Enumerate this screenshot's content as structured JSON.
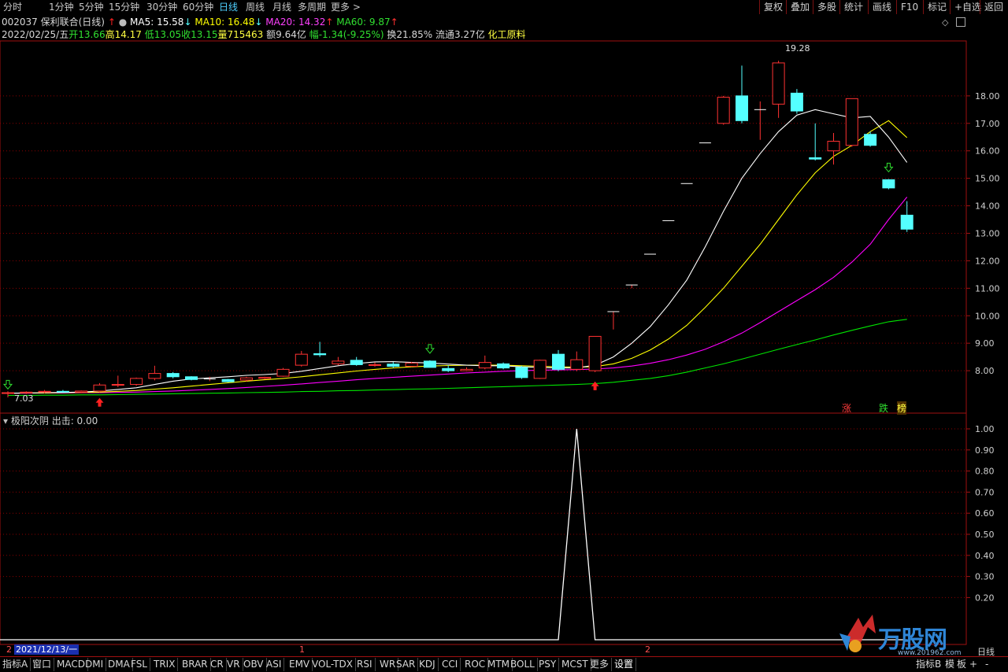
{
  "toolbar": {
    "periods": [
      "分时",
      "1分钟",
      "5分钟",
      "15分钟",
      "30分钟",
      "60分钟",
      "日线",
      "周线",
      "月线",
      "多周期",
      "更多 >"
    ],
    "active_period": "日线",
    "right_buttons": [
      "复权",
      "叠加",
      "多股",
      "统计",
      "画线",
      "F10",
      "标记",
      "+自选",
      "返回"
    ]
  },
  "header": {
    "code_name": "002037 保利联合(日线)",
    "ma5": "MA5: 15.58",
    "ma10": "MA10: 16.48",
    "ma20": "MA20: 14.32",
    "ma60": "MA60: 9.87",
    "date": "2022/02/25/五",
    "open": "开13.66",
    "high": "高14.17",
    "low": "低13.05",
    "close": "收13.15",
    "volume": "量715463",
    "amount": "额9.64亿",
    "change": "幅-1.34(-9.25%)",
    "turnover": "换21.85%",
    "float_cap": "流通3.27亿",
    "sector": "化工原料"
  },
  "colors": {
    "up": "#ff3232",
    "down": "#54ffff",
    "ma5": "#ffffff",
    "ma10": "#ffff00",
    "ma20": "#ff00ff",
    "ma60": "#00e600",
    "grid": "#8b0000",
    "frame": "#a01010"
  },
  "main_chart": {
    "price_ticks": [
      "18.00",
      "17.00",
      "16.00",
      "15.00",
      "14.00",
      "13.00",
      "12.00",
      "11.00",
      "10.00",
      "9.00",
      "8.00"
    ],
    "high_label": "19.28",
    "low_label": "7.03",
    "tags": [
      "涨",
      "跌",
      "榜"
    ]
  },
  "chart_data": [
    {
      "type": "candlestick",
      "title": "002037 保利联合(日线)",
      "ylim": [
        6.6,
        20.0
      ],
      "candles": [
        {
          "o": 7.18,
          "h": 7.25,
          "l": 7.03,
          "c": 7.2
        },
        {
          "o": 7.2,
          "h": 7.25,
          "l": 7.15,
          "c": 7.22
        },
        {
          "o": 7.22,
          "h": 7.3,
          "l": 7.18,
          "c": 7.25
        },
        {
          "o": 7.25,
          "h": 7.3,
          "l": 7.2,
          "c": 7.22
        },
        {
          "o": 7.22,
          "h": 7.28,
          "l": 7.18,
          "c": 7.26
        },
        {
          "o": 7.26,
          "h": 7.55,
          "l": 7.22,
          "c": 7.48
        },
        {
          "o": 7.48,
          "h": 7.82,
          "l": 7.4,
          "c": 7.5
        },
        {
          "o": 7.5,
          "h": 7.75,
          "l": 7.45,
          "c": 7.72
        },
        {
          "o": 7.72,
          "h": 8.18,
          "l": 7.65,
          "c": 7.9
        },
        {
          "o": 7.9,
          "h": 7.95,
          "l": 7.72,
          "c": 7.78
        },
        {
          "o": 7.78,
          "h": 7.8,
          "l": 7.65,
          "c": 7.68
        },
        {
          "o": 7.7,
          "h": 7.78,
          "l": 7.62,
          "c": 7.7
        },
        {
          "o": 7.68,
          "h": 7.7,
          "l": 7.58,
          "c": 7.6
        },
        {
          "o": 7.66,
          "h": 7.78,
          "l": 7.6,
          "c": 7.74
        },
        {
          "o": 7.72,
          "h": 7.78,
          "l": 7.68,
          "c": 7.76
        },
        {
          "o": 7.8,
          "h": 8.1,
          "l": 7.78,
          "c": 8.05
        },
        {
          "o": 8.2,
          "h": 8.72,
          "l": 8.15,
          "c": 8.6
        },
        {
          "o": 8.62,
          "h": 9.05,
          "l": 8.5,
          "c": 8.58
        },
        {
          "o": 8.25,
          "h": 8.5,
          "l": 8.2,
          "c": 8.35
        },
        {
          "o": 8.38,
          "h": 8.5,
          "l": 8.18,
          "c": 8.22
        },
        {
          "o": 8.2,
          "h": 8.3,
          "l": 8.15,
          "c": 8.22
        },
        {
          "o": 8.24,
          "h": 8.32,
          "l": 8.1,
          "c": 8.16
        },
        {
          "o": 8.16,
          "h": 8.32,
          "l": 8.14,
          "c": 8.28
        },
        {
          "o": 8.35,
          "h": 8.38,
          "l": 8.12,
          "c": 8.12
        },
        {
          "o": 8.08,
          "h": 8.2,
          "l": 7.95,
          "c": 8.0
        },
        {
          "o": 8.0,
          "h": 8.12,
          "l": 7.98,
          "c": 8.05
        },
        {
          "o": 8.1,
          "h": 8.55,
          "l": 8.05,
          "c": 8.3
        },
        {
          "o": 8.25,
          "h": 8.3,
          "l": 8.05,
          "c": 8.1
        },
        {
          "o": 8.12,
          "h": 8.18,
          "l": 7.7,
          "c": 7.75
        },
        {
          "o": 7.72,
          "h": 8.4,
          "l": 7.7,
          "c": 8.38
        },
        {
          "o": 8.6,
          "h": 8.75,
          "l": 7.98,
          "c": 8.05
        },
        {
          "o": 8.05,
          "h": 8.7,
          "l": 7.98,
          "c": 8.4
        },
        {
          "o": 8.0,
          "h": 9.25,
          "l": 7.95,
          "c": 9.25
        },
        {
          "o": 10.15,
          "h": 10.15,
          "l": 9.5,
          "c": 10.15
        },
        {
          "o": 11.12,
          "h": 11.12,
          "l": 11.0,
          "c": 11.12
        },
        {
          "o": 12.24,
          "h": 12.24,
          "l": 12.24,
          "c": 12.24
        },
        {
          "o": 13.46,
          "h": 13.46,
          "l": 13.46,
          "c": 13.46
        },
        {
          "o": 14.81,
          "h": 14.81,
          "l": 14.81,
          "c": 14.81
        },
        {
          "o": 16.29,
          "h": 16.29,
          "l": 16.29,
          "c": 16.29
        },
        {
          "o": 17.0,
          "h": 18.0,
          "l": 16.95,
          "c": 17.95
        },
        {
          "o": 18.0,
          "h": 19.1,
          "l": 17.0,
          "c": 17.1
        },
        {
          "o": 17.5,
          "h": 17.8,
          "l": 16.4,
          "c": 17.5
        },
        {
          "o": 17.7,
          "h": 19.28,
          "l": 17.2,
          "c": 19.2
        },
        {
          "o": 18.1,
          "h": 18.25,
          "l": 17.35,
          "c": 17.45
        },
        {
          "o": 15.75,
          "h": 17.0,
          "l": 15.65,
          "c": 15.7
        },
        {
          "o": 16.0,
          "h": 16.65,
          "l": 15.5,
          "c": 16.35
        },
        {
          "o": 16.2,
          "h": 17.9,
          "l": 16.15,
          "c": 17.9
        },
        {
          "o": 16.6,
          "h": 16.7,
          "l": 16.15,
          "c": 16.2
        },
        {
          "o": 14.95,
          "h": 14.97,
          "l": 14.6,
          "c": 14.65
        },
        {
          "o": 13.66,
          "h": 14.17,
          "l": 13.05,
          "c": 13.15
        }
      ],
      "ma5": [
        7.18,
        7.19,
        7.2,
        7.21,
        7.22,
        7.26,
        7.32,
        7.38,
        7.5,
        7.62,
        7.7,
        7.74,
        7.78,
        7.83,
        7.86,
        7.9,
        7.98,
        8.08,
        8.18,
        8.26,
        8.32,
        8.33,
        8.3,
        8.28,
        8.24,
        8.2,
        8.18,
        8.18,
        8.14,
        8.12,
        8.1,
        8.1,
        8.2,
        8.5,
        9.0,
        9.6,
        10.4,
        11.3,
        12.5,
        13.8,
        15.0,
        15.9,
        16.7,
        17.3,
        17.5,
        17.35,
        17.2,
        17.25,
        16.5,
        15.58
      ],
      "ma10": [
        7.18,
        7.19,
        7.19,
        7.2,
        7.21,
        7.22,
        7.25,
        7.28,
        7.33,
        7.38,
        7.44,
        7.5,
        7.56,
        7.62,
        7.67,
        7.72,
        7.78,
        7.85,
        7.92,
        7.99,
        8.05,
        8.1,
        8.14,
        8.17,
        8.19,
        8.2,
        8.2,
        8.2,
        8.18,
        8.16,
        8.14,
        8.13,
        8.15,
        8.25,
        8.45,
        8.75,
        9.15,
        9.65,
        10.3,
        11.0,
        11.8,
        12.6,
        13.5,
        14.4,
        15.2,
        15.8,
        16.2,
        16.7,
        17.1,
        16.48
      ],
      "ma20": [
        7.18,
        7.18,
        7.19,
        7.19,
        7.2,
        7.2,
        7.21,
        7.22,
        7.24,
        7.26,
        7.29,
        7.32,
        7.35,
        7.39,
        7.43,
        7.47,
        7.52,
        7.57,
        7.62,
        7.67,
        7.72,
        7.76,
        7.8,
        7.84,
        7.88,
        7.92,
        7.95,
        7.98,
        8.0,
        8.02,
        8.03,
        8.04,
        8.06,
        8.1,
        8.17,
        8.27,
        8.4,
        8.57,
        8.78,
        9.05,
        9.37,
        9.75,
        10.15,
        10.55,
        10.95,
        11.4,
        11.95,
        12.6,
        13.5,
        14.32
      ],
      "ma60": [
        7.1,
        7.1,
        7.11,
        7.11,
        7.12,
        7.12,
        7.13,
        7.14,
        7.15,
        7.16,
        7.17,
        7.18,
        7.19,
        7.2,
        7.21,
        7.22,
        7.24,
        7.25,
        7.27,
        7.28,
        7.3,
        7.31,
        7.33,
        7.34,
        7.36,
        7.38,
        7.4,
        7.42,
        7.44,
        7.46,
        7.48,
        7.5,
        7.53,
        7.58,
        7.65,
        7.72,
        7.82,
        7.95,
        8.1,
        8.25,
        8.42,
        8.6,
        8.78,
        8.95,
        9.12,
        9.3,
        9.47,
        9.63,
        9.78,
        9.87
      ]
    },
    {
      "type": "line",
      "title": "极阳次阴 出击: 0.00",
      "ylim": [
        0,
        1.0
      ],
      "y_ticks": [
        "1.00",
        "0.90",
        "0.80",
        "0.70",
        "0.60",
        "0.50",
        "0.40",
        "0.30",
        "0.20"
      ],
      "values": [
        0,
        0,
        0,
        0,
        0,
        0,
        0,
        0,
        0,
        0,
        0,
        0,
        0,
        0,
        0,
        0,
        0,
        0,
        0,
        0,
        0,
        0,
        0,
        0,
        0,
        0,
        0,
        0,
        0,
        0,
        0,
        1,
        0,
        0,
        0,
        0,
        0,
        0,
        0,
        0,
        0,
        0,
        0,
        0,
        0,
        0,
        0,
        0,
        0,
        0
      ]
    }
  ],
  "indicator": {
    "title": "极阳次阴",
    "output": "出击: 0.00"
  },
  "xaxis": {
    "date_label": "2021/12/13/一",
    "marker_left": "2",
    "month_1": "1",
    "month_2": "2",
    "period_label": "日线"
  },
  "bottom_tabs": [
    "指标A",
    "窗口",
    "MACD",
    "DMI",
    "DMA",
    "FSL",
    "TRIX",
    "BRAR",
    "CR",
    "VR",
    "OBV",
    "ASI",
    "EMV",
    "VOL-TDX",
    "RSI",
    "WR",
    "SAR",
    "KDJ",
    "CCI",
    "ROC",
    "MTM",
    "BOLL",
    "PSY",
    "MCST",
    "更多",
    "设置"
  ],
  "bottom_right": [
    "指标B",
    "模",
    "板",
    "+",
    "-"
  ],
  "watermark": {
    "brand": "万股网",
    "url": "www.201962.com"
  }
}
